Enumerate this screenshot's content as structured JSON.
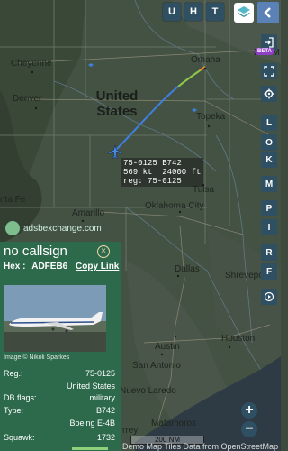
{
  "toolbar": {
    "u_label": "U",
    "h_label": "H",
    "t_label": "T",
    "layers_icon": "layers-icon",
    "collapse_icon": "chevron-left-icon"
  },
  "side_buttons": {
    "login_icon": "login-icon",
    "beta_badge": "BETA",
    "fullscreen_icon": "fullscreen-icon",
    "settings_icon": "gear-icon",
    "L": "L",
    "O": "O",
    "K": "K",
    "M": "M",
    "P": "P",
    "I": "I",
    "R": "R",
    "F": "F",
    "replay_icon": "replay-icon"
  },
  "map": {
    "country_label_line1": "United",
    "country_label_line2": "States",
    "cities": [
      {
        "name": "Cheyenne"
      },
      {
        "name": "Denver"
      },
      {
        "name": "Omaha"
      },
      {
        "name": "Des M"
      },
      {
        "name": "Topeka"
      },
      {
        "name": "Tulsa"
      },
      {
        "name": "Amarillo"
      },
      {
        "name": "Oklahoma City"
      },
      {
        "name": "nta Fe"
      },
      {
        "name": "Dallas"
      },
      {
        "name": "Shrevepo"
      },
      {
        "name": "Austin"
      },
      {
        "name": "San Antonio"
      },
      {
        "name": "Houston"
      },
      {
        "name": "Nuevo Laredo"
      },
      {
        "name": "Matamoros"
      },
      {
        "name": "rrey"
      }
    ],
    "scale_label": "200 NM",
    "attribution": "Demo Map Tiles Data from OpenStreetMap"
  },
  "aircraft_label": {
    "line1": "75-0125 B742",
    "line2": "569 kt  24000 ft",
    "line3": "reg: 75-0125"
  },
  "branding": {
    "site": "adsbexchange.com"
  },
  "info_panel": {
    "callsign": "no callsign",
    "hex_label": "Hex :",
    "hex_value": "ADFEB6",
    "copy_link": "Copy Link",
    "close_icon": "close-icon",
    "photo_credit": "Image © Nikoli Sparkes",
    "rows": [
      {
        "key": "Reg.:",
        "value": "75-0125"
      },
      {
        "key": "",
        "value": "United States"
      },
      {
        "key": "DB flags:",
        "value": "military"
      },
      {
        "key": "Type:",
        "value": "B742"
      },
      {
        "key": "",
        "value": "Boeing E-4B"
      },
      {
        "key": "Squawk:",
        "value": "1732"
      }
    ]
  },
  "zoom": {
    "in_label": "+",
    "out_label": "−"
  },
  "colors": {
    "accent_button": "#2f4f63",
    "panel_bg": "#2d6a4c",
    "track_blue": "#3f7fe0",
    "track_orange": "#e8962a",
    "beta": "#8e3fc4"
  }
}
